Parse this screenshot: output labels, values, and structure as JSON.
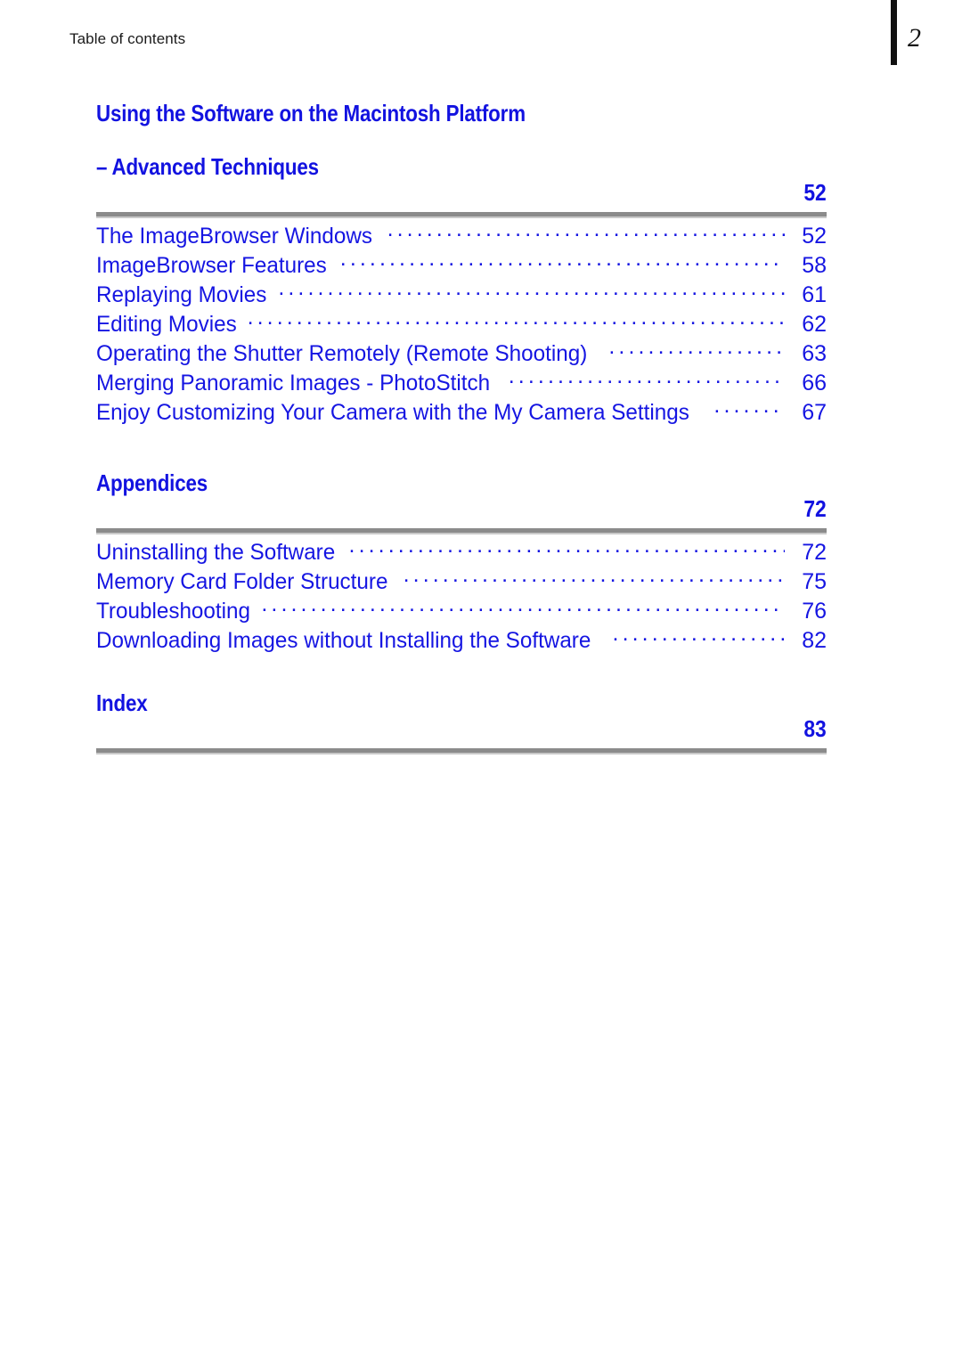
{
  "header": {
    "running_title": "Table of contents",
    "folio": "2"
  },
  "colors": {
    "link_blue": "#1515E2",
    "heading_blue": "#1212E0",
    "rule_gray": "#8b8b8b",
    "rule_gray_light": "#c9c9c9",
    "text_black": "#1a1a1a"
  },
  "sections": [
    {
      "title_line_1": "Using the Software on the Macintosh Platform",
      "title_line_2": "– Advanced Techniques",
      "page": "52",
      "entries": [
        {
          "label": "The ImageBrowser Windows",
          "page": "52"
        },
        {
          "label": "ImageBrowser Features",
          "page": "58"
        },
        {
          "label": "Replaying Movies",
          "page": "61"
        },
        {
          "label": "Editing Movies",
          "page": "62"
        },
        {
          "label": "Operating the Shutter Remotely (Remote Shooting)",
          "page": "63"
        },
        {
          "label": "Merging Panoramic Images - PhotoStitch",
          "page": "66"
        },
        {
          "label": "Enjoy Customizing Your Camera with the My Camera Settings",
          "page": "67"
        }
      ]
    },
    {
      "title_line_1": "Appendices",
      "title_line_2": "",
      "page": "72",
      "entries": [
        {
          "label": "Uninstalling the Software",
          "page": "72"
        },
        {
          "label": "Memory Card Folder Structure",
          "page": "75"
        },
        {
          "label": "Troubleshooting",
          "page": "76"
        },
        {
          "label": "Downloading Images without Installing the Software",
          "page": "82"
        }
      ]
    },
    {
      "title_line_1": "Index",
      "title_line_2": "",
      "page": "83",
      "entries": []
    }
  ]
}
